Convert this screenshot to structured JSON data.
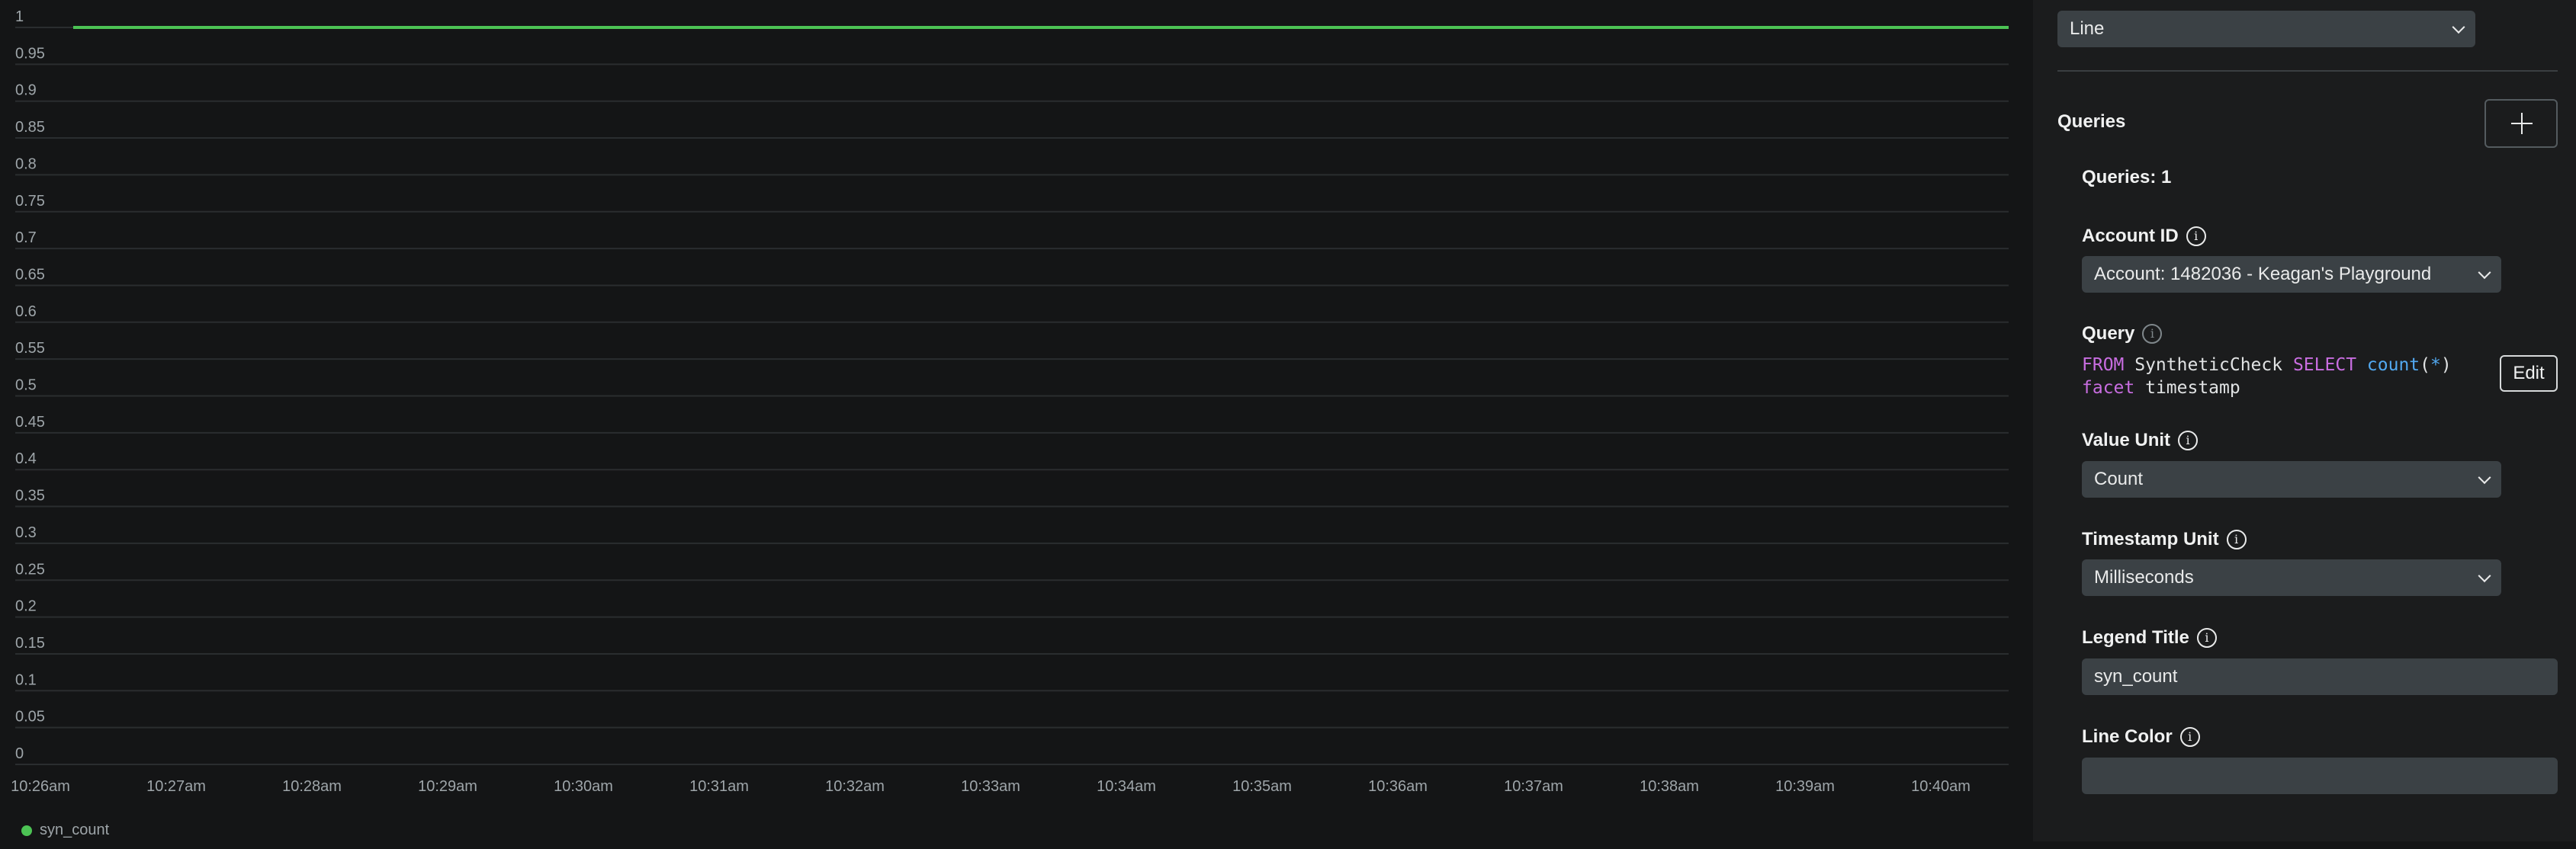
{
  "chart_data": {
    "type": "line",
    "title": "",
    "xlabel": "",
    "ylabel": "",
    "ylim": [
      0,
      1
    ],
    "y_ticks": [
      "0",
      "0.05",
      "0.1",
      "0.15",
      "0.2",
      "0.25",
      "0.3",
      "0.35",
      "0.4",
      "0.45",
      "0.5",
      "0.55",
      "0.6",
      "0.65",
      "0.7",
      "0.75",
      "0.8",
      "0.85",
      "0.9",
      "0.95",
      "1"
    ],
    "x_ticks": [
      "10:26am",
      "10:27am",
      "10:28am",
      "10:29am",
      "10:30am",
      "10:31am",
      "10:32am",
      "10:33am",
      "10:34am",
      "10:35am",
      "10:36am",
      "10:37am",
      "10:38am",
      "10:39am",
      "10:40am"
    ],
    "grid": true,
    "legend_position": "bottom-left",
    "series": [
      {
        "name": "syn_count",
        "color": "#4cc354",
        "x": [
          "10:26am",
          "10:40am"
        ],
        "values": [
          1,
          1
        ]
      }
    ]
  },
  "legend": {
    "label": "syn_count",
    "color": "#4cc354"
  },
  "panel": {
    "chart_type": "Line",
    "queries_heading": "Queries",
    "queries_count": "Queries: 1",
    "account_id": {
      "label": "Account ID",
      "value": "Account: 1482036 - Keagan's Playground"
    },
    "query": {
      "label": "Query",
      "line1": {
        "k1": "FROM",
        "t1": " SyntheticCheck ",
        "k2": "SELECT",
        "sp": " ",
        "fn": "count",
        "p1": "(",
        "ast": "*",
        "p2": ")"
      },
      "line2": {
        "k1": "facet",
        "t1": " timestamp"
      },
      "edit_label": "Edit"
    },
    "value_unit": {
      "label": "Value Unit",
      "value": "Count"
    },
    "timestamp_unit": {
      "label": "Timestamp Unit",
      "value": "Milliseconds"
    },
    "legend_title": {
      "label": "Legend Title",
      "value": "syn_count"
    },
    "line_color": {
      "label": "Line Color",
      "value": ""
    }
  },
  "icons": {
    "info": "i",
    "add": "plus-icon",
    "chevron": "chevron-down-icon"
  },
  "colors": {
    "background": "#141516",
    "panel": "#1b1c1d",
    "input": "#3b4145",
    "series": "#4cc354",
    "keyword": "#c86de0",
    "function": "#52a9f1"
  }
}
